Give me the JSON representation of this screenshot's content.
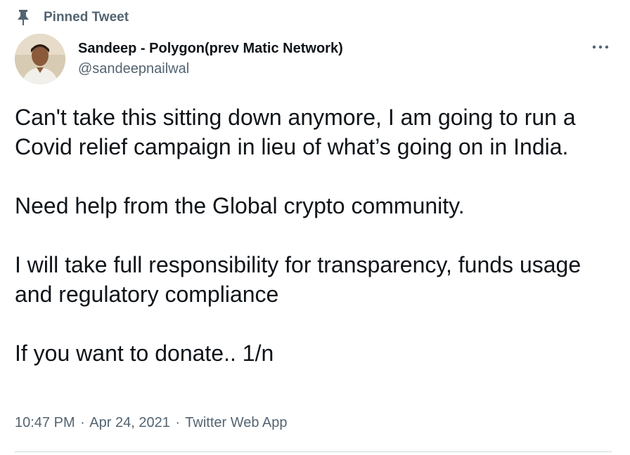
{
  "pinned": {
    "label": "Pinned Tweet",
    "icon": "pin-icon"
  },
  "author": {
    "name": "Sandeep - Polygon(prev Matic Network)",
    "handle": "@sandeepnailwal",
    "avatar_icon": "avatar"
  },
  "more_icon": "more-icon",
  "tweet": {
    "paragraphs": [
      "Can't take this sitting down anymore, I am going to run a Covid relief campaign in lieu of what’s going on in India.",
      "Need help from the Global crypto community.",
      "I will take full responsibility for transparency, funds usage and regulatory compliance",
      "If you want to donate.. 1/n"
    ]
  },
  "meta": {
    "time": "10:47 PM",
    "separator": "·",
    "date": "Apr 24, 2021",
    "source": "Twitter Web App"
  },
  "colors": {
    "text": "#0f1419",
    "secondary": "#536471",
    "divider": "#cfd9de"
  }
}
